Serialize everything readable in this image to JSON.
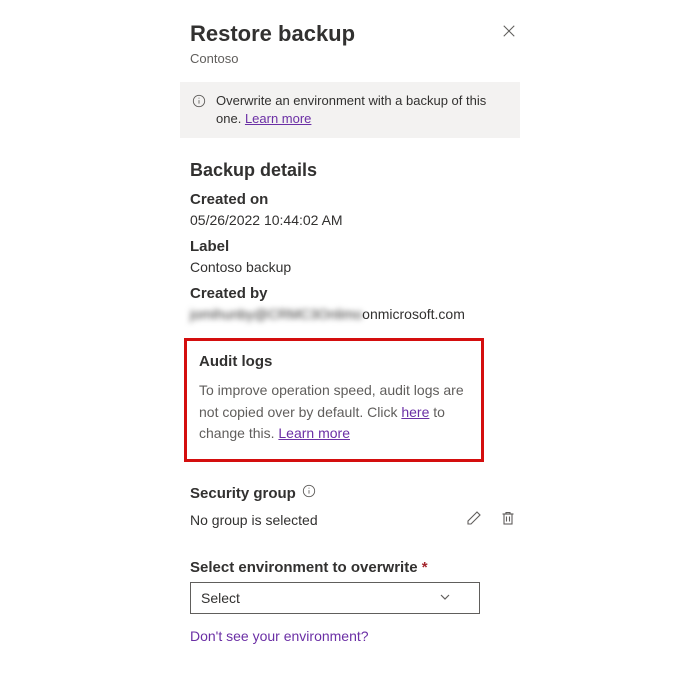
{
  "header": {
    "title": "Restore backup",
    "subtitle": "Contoso"
  },
  "banner": {
    "text": "Overwrite an environment with a backup of this one.",
    "learn_more": "Learn more"
  },
  "backup": {
    "heading": "Backup details",
    "created_on_label": "Created on",
    "created_on_value": "05/26/2022 10:44:02 AM",
    "label_label": "Label",
    "label_value": "Contoso backup",
    "created_by_label": "Created by",
    "created_by_blurred": "jomihunby@CRMC3Onlimo",
    "created_by_suffix": "onmicrosoft.com"
  },
  "audit": {
    "heading": "Audit logs",
    "text_a": "To improve operation speed, audit logs are not copied over by default. Click ",
    "here": "here",
    "text_b": " to change this. ",
    "learn_more": "Learn more"
  },
  "security": {
    "label": "Security group",
    "value": "No group is selected"
  },
  "environment": {
    "label": "Select environment to overwrite",
    "placeholder": "Select",
    "not_listed": "Don't see your environment?"
  }
}
